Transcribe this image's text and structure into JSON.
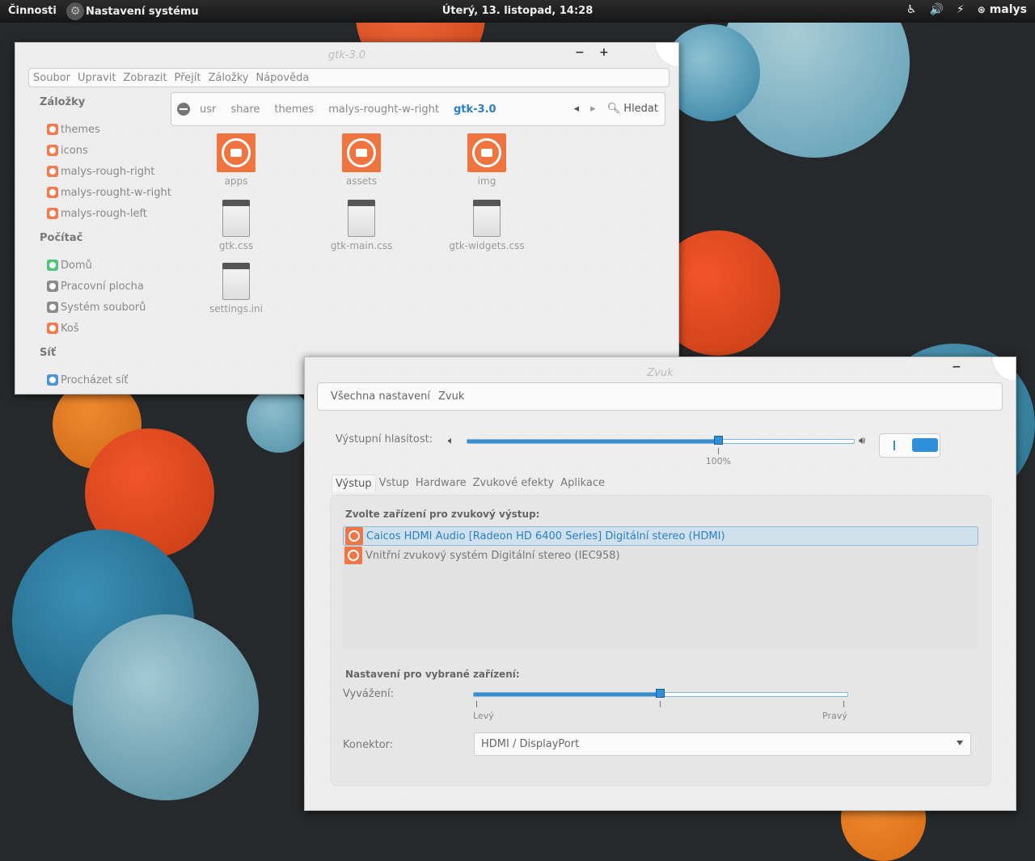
{
  "topbar": {
    "activities": "Činnosti",
    "app_name": "Nastavení systému",
    "clock": "Úterý, 13. listopad, 14:28",
    "user": "malys"
  },
  "file_manager": {
    "title": "gtk-3.0",
    "minimize": "−",
    "maximize": "+",
    "menu": [
      "Soubor",
      "Upravit",
      "Zobrazit",
      "Přejít",
      "Záložky",
      "Nápověda"
    ],
    "sidebar": {
      "bookmarks_heading": "Záložky",
      "bookmarks": [
        "themes",
        "icons",
        "malys-rough-right",
        "malys-rought-w-right",
        "malys-rough-left"
      ],
      "computer_heading": "Počítač",
      "computer": [
        "Domů",
        "Pracovní plocha",
        "Systém souborů",
        "Koš"
      ],
      "network_heading": "Síť",
      "network": [
        "Procházet síť"
      ]
    },
    "path": [
      "usr",
      "share",
      "themes",
      "malys-rought-w-right",
      "gtk-3.0"
    ],
    "search_label": "Hledat",
    "folders": [
      "apps",
      "assets",
      "img"
    ],
    "files": [
      "gtk.css",
      "gtk-main.css",
      "gtk-widgets.css",
      "settings.ini"
    ]
  },
  "sound": {
    "title": "Zvuk",
    "minimize": "−",
    "breadcrumb": [
      "Všechna nastavení",
      "Zvuk"
    ],
    "volume_label": "Výstupní hlasitost:",
    "volume_percent": "100%",
    "volume_value": 0.65,
    "tabs": [
      "Výstup",
      "Vstup",
      "Hardware",
      "Zvukové efekty",
      "Aplikace"
    ],
    "active_tab": 0,
    "device_heading": "Zvolte zařízení pro zvukový výstup:",
    "devices": [
      "Caicos HDMI Audio [Radeon HD 6400 Series] Digitální stereo (HDMI)",
      "Vnitřní zvukový systém Digitální stereo (IEC958)"
    ],
    "selected_device": 0,
    "settings_heading": "Nastavení pro vybrané zařízení:",
    "balance_label": "Vyvážení:",
    "balance_value": 0.5,
    "balance_left": "Levý",
    "balance_right": "Pravý",
    "connector_label": "Konektor:",
    "connector_value": "HDMI / DisplayPort"
  },
  "colors": {
    "accent": "#2f8fd8",
    "folder": "#ef7440",
    "background": "#26292b"
  }
}
